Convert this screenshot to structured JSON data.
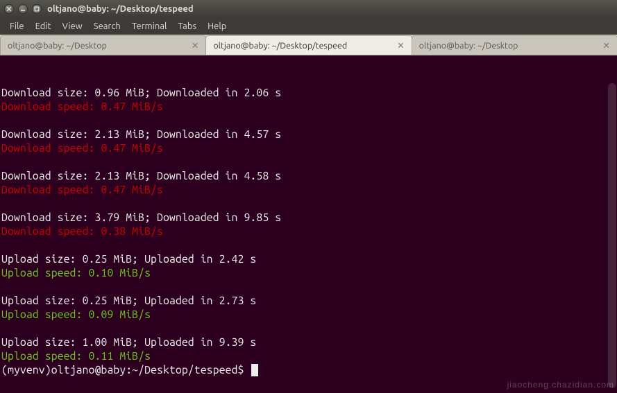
{
  "window": {
    "title": "oltjano@baby: ~/Desktop/tespeed"
  },
  "menubar": {
    "items": [
      "File",
      "Edit",
      "View",
      "Search",
      "Terminal",
      "Tabs",
      "Help"
    ]
  },
  "tabs": {
    "list": [
      {
        "label": "oltjano@baby: ~/Desktop",
        "active": false
      },
      {
        "label": "oltjano@baby: ~/Desktop/tespeed",
        "active": true
      },
      {
        "label": "oltjano@baby: ~/Desktop",
        "active": false
      }
    ],
    "close_glyph": "✕"
  },
  "terminal": {
    "blocks": [
      {
        "info": "Download size: 0.96 MiB; Downloaded in 2.06 s",
        "speed": "Download speed: 0.47 MiB/s",
        "kind": "download"
      },
      {
        "info": "Download size: 2.13 MiB; Downloaded in 4.57 s",
        "speed": "Download speed: 0.47 MiB/s",
        "kind": "download"
      },
      {
        "info": "Download size: 2.13 MiB; Downloaded in 4.58 s",
        "speed": "Download speed: 0.47 MiB/s",
        "kind": "download"
      },
      {
        "info": "Download size: 3.79 MiB; Downloaded in 9.85 s",
        "speed": "Download speed: 0.38 MiB/s",
        "kind": "download"
      },
      {
        "info": "Upload size: 0.25 MiB; Uploaded in 2.42 s",
        "speed": "Upload speed: 0.10 MiB/s",
        "kind": "upload"
      },
      {
        "info": "Upload size: 0.25 MiB; Uploaded in 2.73 s",
        "speed": "Upload speed: 0.09 MiB/s",
        "kind": "upload"
      },
      {
        "info": "Upload size: 1.00 MiB; Uploaded in 9.39 s",
        "speed": "Upload speed: 0.11 MiB/s",
        "kind": "upload"
      }
    ],
    "prompt": "(myvenv)oltjano@baby:~/Desktop/tespeed$ "
  },
  "watermark": "jiaocheng.chazidian.com",
  "colors": {
    "terminal_bg": "#2c001e",
    "download_speed": "#cc0000",
    "upload_speed": "#6ec71e",
    "text": "#eeeeec"
  }
}
